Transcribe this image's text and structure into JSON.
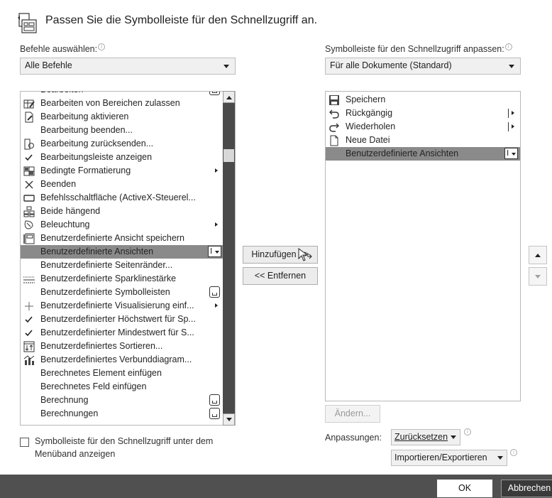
{
  "dialog": {
    "title": "Passen Sie die Symbolleiste für den Schnellzugriff an.",
    "icon": "customize-toolbar-icon"
  },
  "left": {
    "choose_label": "Befehle auswählen:",
    "choose_value": "Alle Befehle",
    "items": [
      {
        "label": "Bearbeiten",
        "icon": "",
        "extra": "control"
      },
      {
        "label": "Bearbeiten von Bereichen zulassen",
        "icon": "allow-edit-ranges-icon",
        "extra": ""
      },
      {
        "label": "Bearbeitung aktivieren",
        "icon": "enable-editing-icon",
        "extra": ""
      },
      {
        "label": "Bearbeitung beenden...",
        "icon": "",
        "extra": ""
      },
      {
        "label": "Bearbeitung zurücksenden...",
        "icon": "send-back-icon",
        "extra": ""
      },
      {
        "label": "Bearbeitungsleiste anzeigen",
        "icon": "checkmark-icon",
        "extra": ""
      },
      {
        "label": "Bedingte Formatierung",
        "icon": "conditional-format-icon",
        "extra": "submenu"
      },
      {
        "label": "Beenden",
        "icon": "close-x-icon",
        "extra": ""
      },
      {
        "label": "Befehlsschaltfläche (ActiveX-Steuerel...",
        "icon": "command-button-icon",
        "extra": ""
      },
      {
        "label": "Beide hängend",
        "icon": "arrange-icon",
        "extra": ""
      },
      {
        "label": "Beleuchtung",
        "icon": "lighting-icon",
        "extra": "submenu"
      },
      {
        "label": "Benutzerdefinierte Ansicht speichern",
        "icon": "save-view-icon",
        "extra": ""
      },
      {
        "label": "Benutzerdefinierte Ansichten",
        "icon": "",
        "extra": "ibeam",
        "selected": true
      },
      {
        "label": "Benutzerdefinierte Seitenränder...",
        "icon": "",
        "extra": ""
      },
      {
        "label": "Benutzerdefinierte Sparklinestärke",
        "icon": "sparkline-weight-icon",
        "extra": ""
      },
      {
        "label": "Benutzerdefinierte Symbolleisten",
        "icon": "",
        "extra": "control"
      },
      {
        "label": "Benutzerdefinierte Visualisierung einf...",
        "icon": "plus-icon",
        "extra": "submenu"
      },
      {
        "label": "Benutzerdefinierter Höchstwert für Sp...",
        "icon": "checkmark-icon",
        "extra": ""
      },
      {
        "label": "Benutzerdefinierter Mindestwert für S...",
        "icon": "checkmark-icon",
        "extra": ""
      },
      {
        "label": "Benutzerdefiniertes Sortieren...",
        "icon": "sort-icon",
        "extra": ""
      },
      {
        "label": "Benutzerdefiniertes Verbunddiagram...",
        "icon": "combo-chart-icon",
        "extra": ""
      },
      {
        "label": "Berechnetes Element einfügen",
        "icon": "",
        "extra": ""
      },
      {
        "label": "Berechnetes Feld einfügen",
        "icon": "",
        "extra": ""
      },
      {
        "label": "Berechnung",
        "icon": "",
        "extra": "control"
      },
      {
        "label": "Berechnungen",
        "icon": "",
        "extra": "control"
      }
    ],
    "below_ribbon_checkbox_line1": "Symbolleiste für den Schnellzugriff unter dem",
    "below_ribbon_checkbox_line2": "Menüband anzeigen"
  },
  "middle": {
    "add_label": "Hinzufügen >>",
    "remove_label": "<< Entfernen"
  },
  "right": {
    "customize_label": "Symbolleiste für den Schnellzugriff anpassen:",
    "customize_value": "Für alle Dokumente (Standard)",
    "items": [
      {
        "label": "Speichern",
        "icon": "save-icon",
        "extra": ""
      },
      {
        "label": "Rückgängig",
        "icon": "undo-icon",
        "extra": "split"
      },
      {
        "label": "Wiederholen",
        "icon": "redo-icon",
        "extra": "split"
      },
      {
        "label": "Neue Datei",
        "icon": "new-file-icon",
        "extra": ""
      },
      {
        "label": "Benutzerdefinierte Ansichten",
        "icon": "",
        "extra": "ibeam",
        "selected": true
      }
    ],
    "modify_label": "Ändern...",
    "customizations_label": "Anpassungen:",
    "reset_label": "Zurücksetzen",
    "import_export_label": "Importieren/Exportieren"
  },
  "footer": {
    "ok_label": "OK",
    "cancel_label": "Abbrechen"
  },
  "colors": {
    "selection": "#8a8a8a",
    "scrollbar_track": "#4a4a4a",
    "footer_bg": "#505050"
  }
}
